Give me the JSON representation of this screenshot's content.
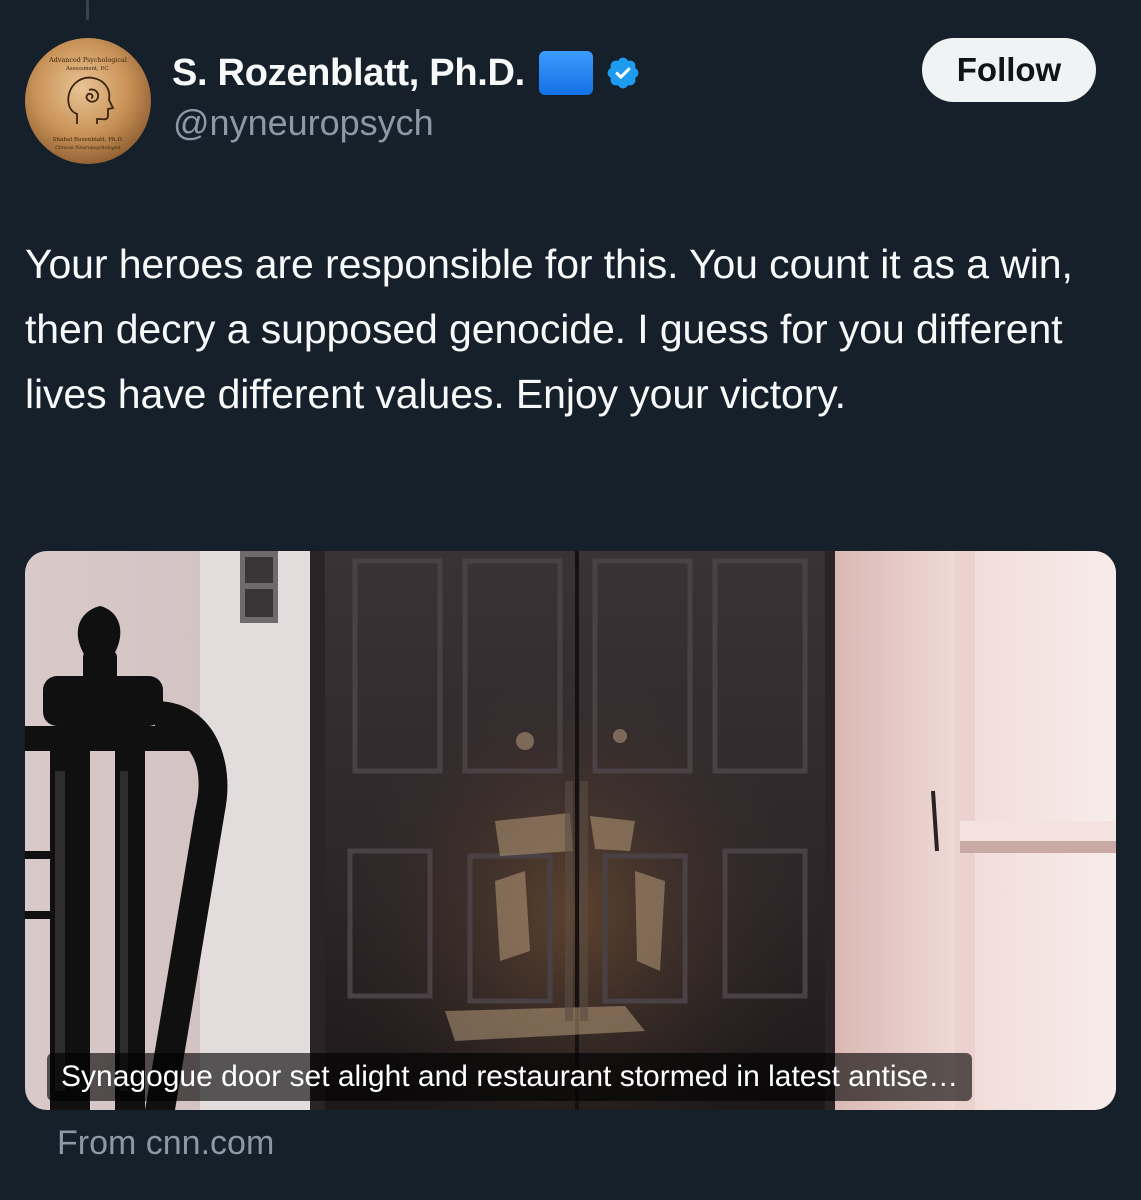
{
  "tweet": {
    "author": {
      "display_name": "S. Rozenblatt, Ph.D.",
      "handle": "@nyneuropsych",
      "verified": true,
      "badge_emoji": "blue-square",
      "avatar": {
        "icon": "head-spiral-logo",
        "top_text_line1": "Advanced Psychological",
        "top_text_line2": "Assessment, P.C.",
        "bottom_text_line1": "Shahal Rozenblatt, Ph.D.",
        "bottom_text_line2": "Clinical Neuropsychologist"
      }
    },
    "follow_label": "Follow",
    "text": "Your heroes are responsible for this. You count it as a win, then decry a supposed genocide. I guess for you different lives have different values. Enjoy your victory.",
    "card": {
      "image": "burned-synagogue-door-photo",
      "caption": "Synagogue door set alight and restaurant stormed in latest antise…",
      "source": "From cnn.com"
    }
  },
  "colors": {
    "background": "#15202b",
    "text_primary": "#f7f9f9",
    "text_secondary": "#8b98a5",
    "follow_bg": "#eff3f4",
    "verified_blue": "#1d9bf0"
  }
}
